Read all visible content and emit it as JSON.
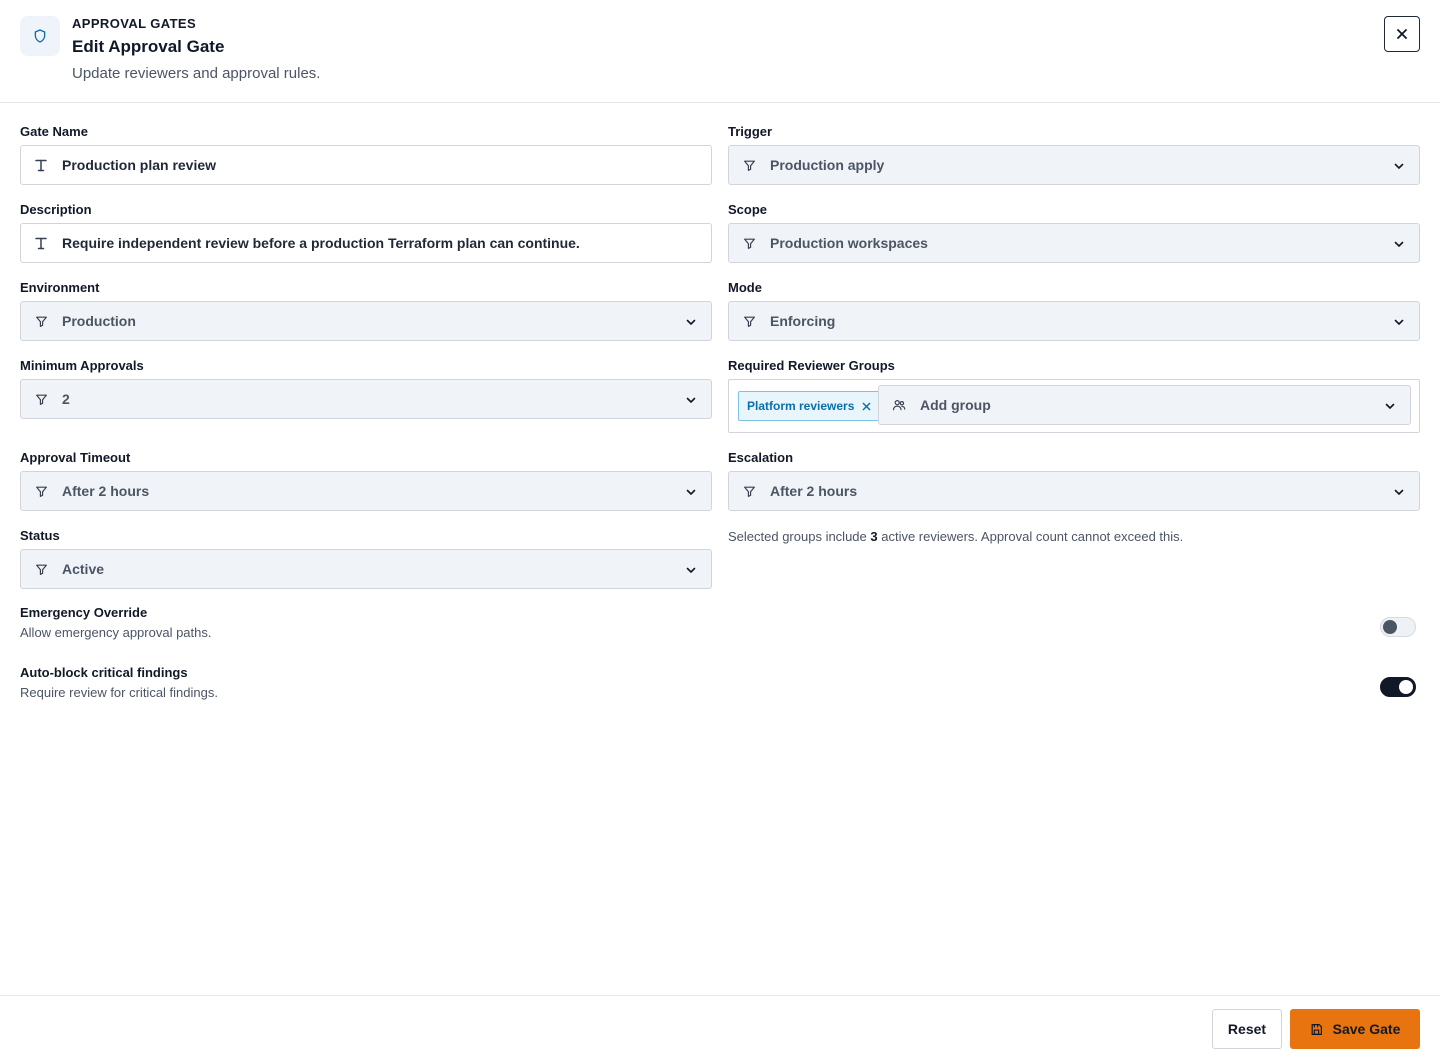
{
  "header": {
    "eyebrow": "APPROVAL GATES",
    "title": "Edit Approval Gate",
    "subtitle": "Update reviewers and approval rules.",
    "icon": "shield-icon",
    "close_icon": "close-icon"
  },
  "form": {
    "gate_name": {
      "label": "Gate Name",
      "value": "Production plan review"
    },
    "description": {
      "label": "Description",
      "value": "Require independent review before a production Terraform plan can continue."
    },
    "environment": {
      "label": "Environment",
      "value": "Production"
    },
    "minimum_approvals": {
      "label": "Minimum Approvals",
      "value": "2"
    },
    "approval_timeout": {
      "label": "Approval Timeout",
      "value": "After 2 hours"
    },
    "status": {
      "label": "Status",
      "value": "Active"
    },
    "trigger": {
      "label": "Trigger",
      "value": "Production apply"
    },
    "scope": {
      "label": "Scope",
      "value": "Production workspaces"
    },
    "mode": {
      "label": "Mode",
      "value": "Enforcing"
    },
    "reviewer_groups": {
      "label": "Required Reviewer Groups",
      "chips": [
        "Platform reviewers"
      ],
      "add_placeholder": "Add group"
    },
    "escalation": {
      "label": "Escalation",
      "value": "After 2 hours"
    },
    "reviewer_hint": {
      "prefix": "Selected groups include ",
      "count": "3",
      "suffix": " active reviewers. Approval count cannot exceed this."
    }
  },
  "toggles": {
    "emergency_override": {
      "title": "Emergency Override",
      "description": "Allow emergency approval paths.",
      "enabled": false
    },
    "auto_block": {
      "title": "Auto-block critical findings",
      "description": "Require review for critical findings.",
      "enabled": true
    }
  },
  "footer": {
    "reset_label": "Reset",
    "save_label": "Save Gate",
    "save_icon": "save-icon"
  },
  "colors": {
    "accent": "#e8740f",
    "chip_text": "#0a6fa8",
    "chip_bg": "#e8f5fc",
    "select_bg": "#f0f3f7"
  }
}
